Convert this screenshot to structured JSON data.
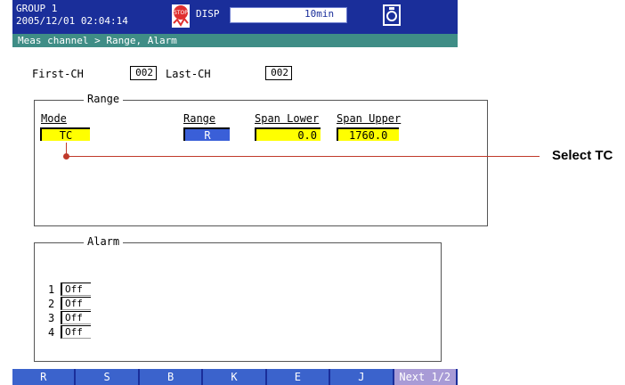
{
  "header": {
    "group_line1": "GROUP 1",
    "group_line2": "2005/12/01 02:04:14",
    "disp_label": "DISP",
    "disp_interval": "10min"
  },
  "breadcrumb": "Meas channel > Range, Alarm",
  "channels": {
    "first_label": "First-CH",
    "first_value": "002",
    "last_label": "Last-CH",
    "last_value": "002"
  },
  "range_group": {
    "title": "Range",
    "mode_label": "Mode",
    "mode_value": "TC",
    "range_label": "Range",
    "range_value": "R",
    "span_lower_label": "Span Lower",
    "span_lower_value": "0.0",
    "span_upper_label": "Span Upper",
    "span_upper_value": "1760.0"
  },
  "alarm_group": {
    "title": "Alarm",
    "rows": [
      {
        "num": "1",
        "value": "Off"
      },
      {
        "num": "2",
        "value": "Off"
      },
      {
        "num": "3",
        "value": "Off"
      },
      {
        "num": "4",
        "value": "Off"
      }
    ]
  },
  "softkeys": [
    "R",
    "S",
    "B",
    "K",
    "E",
    "J",
    "Next 1/2"
  ],
  "callout": "Select TC",
  "colors": {
    "title_bar": "#1a2e9a",
    "sub_bar": "#3f8d86",
    "selected_field": "#ffff00",
    "range_field": "#3a5fd8",
    "softkey": "#3b63cc",
    "callout_line": "#c0392b"
  }
}
